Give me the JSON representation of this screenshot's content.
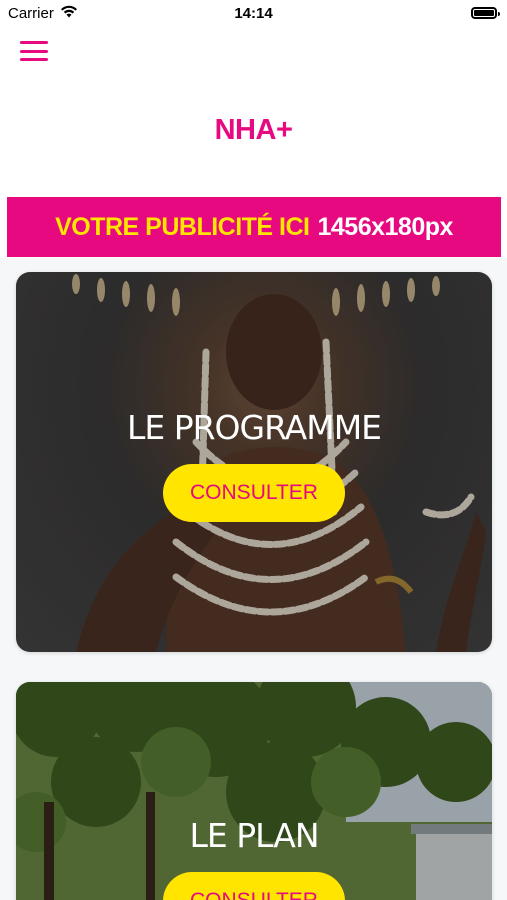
{
  "status_bar": {
    "carrier": "Carrier",
    "time": "14:14"
  },
  "header": {
    "title": "NHA+"
  },
  "ad_banner": {
    "text_yellow": "VOTRE PUBLICITÉ ICI",
    "text_white": "1456x180px"
  },
  "cards": [
    {
      "title": "LE PROGRAMME",
      "button_label": "CONSULTER"
    },
    {
      "title": "LE PLAN",
      "button_label": "CONSULTER"
    }
  ],
  "colors": {
    "brand_pink": "#e6097f",
    "brand_yellow": "#ffe500"
  }
}
